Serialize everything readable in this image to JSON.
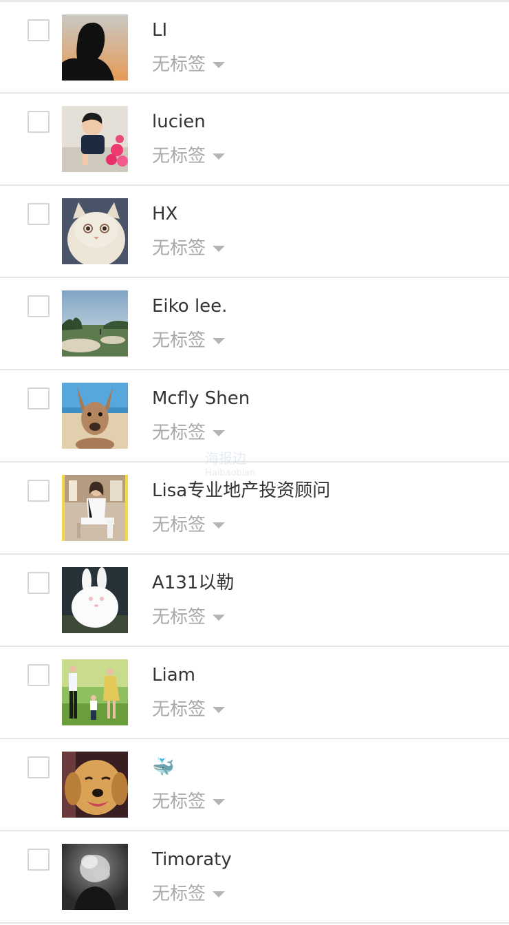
{
  "contacts": [
    {
      "name": "LI",
      "tag": "无标签",
      "avatar_icon": "person-silhouette-sunset-photo"
    },
    {
      "name": "lucien",
      "tag": "无标签",
      "avatar_icon": "toddler-with-flowers-photo"
    },
    {
      "name": "HX",
      "tag": "无标签",
      "avatar_icon": "fluffy-cat-photo"
    },
    {
      "name": "Eiko lee.",
      "tag": "无标签",
      "avatar_icon": "golf-course-landscape-photo"
    },
    {
      "name": "Mcfly Shen",
      "tag": "无标签",
      "avatar_icon": "kangaroo-beach-photo"
    },
    {
      "name": "Lisa专业地产投资顾问",
      "tag": "无标签",
      "avatar_icon": "woman-seated-photo"
    },
    {
      "name": "A131以勒",
      "tag": "无标签",
      "avatar_icon": "white-rabbit-photo"
    },
    {
      "name": "Liam",
      "tag": "无标签",
      "avatar_icon": "family-walking-photo"
    },
    {
      "name": "🐳",
      "tag": "无标签",
      "avatar_icon": "golden-retriever-photo"
    },
    {
      "name": "Timoraty",
      "tag": "无标签",
      "avatar_icon": "smoke-portrait-photo"
    }
  ],
  "watermark": {
    "text": "海报边",
    "sub": "Haibaobian"
  }
}
